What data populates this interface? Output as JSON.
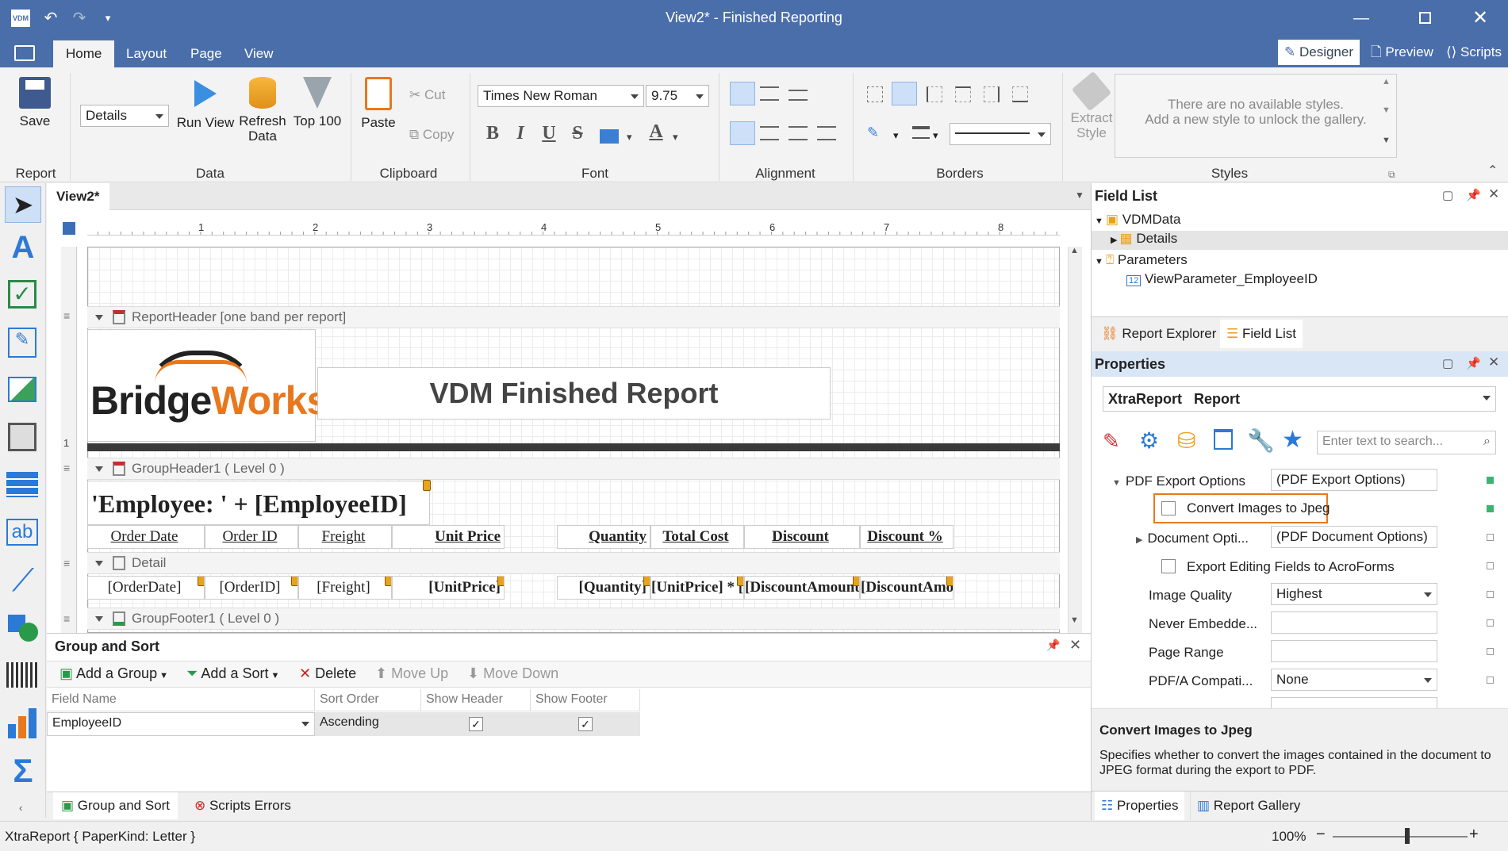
{
  "window": {
    "title": "View2* - Finished Reporting",
    "logo": "VDM"
  },
  "menu": {
    "tabs": [
      "Home",
      "Layout",
      "Page",
      "View"
    ],
    "active_tab": "Home",
    "view_buttons": {
      "designer": "Designer",
      "preview": "Preview",
      "scripts": "Scripts"
    }
  },
  "ribbon": {
    "report": {
      "save": "Save",
      "group": "Report"
    },
    "data": {
      "datasource": "Details",
      "run_view": "Run View",
      "refresh": "Refresh Data",
      "top100": "Top 100",
      "group": "Data"
    },
    "clipboard": {
      "paste": "Paste",
      "cut": "Cut",
      "copy": "Copy",
      "group": "Clipboard"
    },
    "font": {
      "family": "Times New Roman",
      "size": "9.75",
      "group": "Font"
    },
    "alignment": {
      "group": "Alignment"
    },
    "borders": {
      "group": "Borders"
    },
    "styles": {
      "extract": "Extract Style",
      "empty_line1": "There are no available styles.",
      "empty_line2": "Add a new style to unlock the gallery.",
      "group": "Styles"
    }
  },
  "designer": {
    "doc_tab": "View2*",
    "ruler_marks": [
      "1",
      "2",
      "3",
      "4",
      "5",
      "6",
      "7",
      "8"
    ],
    "bands": {
      "report_header": "ReportHeader [one band per report]",
      "group_header": "GroupHeader1 ( Level 0 )",
      "detail": "Detail",
      "group_footer": "GroupFooter1 ( Level 0 )"
    },
    "logo_text": {
      "bridge": "Bridge",
      "works": "Works"
    },
    "report_title": "VDM Finished Report",
    "group_expression": "'Employee: ' + [EmployeeID]",
    "column_headers": [
      "Order Date",
      "Order ID",
      "Freight",
      "Unit Price",
      "Quantity",
      "Total Cost",
      "Discount Amount",
      "Discount %"
    ],
    "detail_cells": [
      "[OrderDate]",
      "[OrderID]",
      "[Freight]",
      "[UnitPrice]",
      "[Quantity]",
      "[UnitPrice] * [Q",
      "[DiscountAmount]",
      "[DiscountAmou"
    ]
  },
  "group_sort": {
    "title": "Group and Sort",
    "toolbar": {
      "add_group": "Add a Group",
      "add_sort": "Add a Sort",
      "delete": "Delete",
      "move_up": "Move Up",
      "move_down": "Move Down"
    },
    "columns": [
      "Field Name",
      "Sort Order",
      "Show Header",
      "Show Footer"
    ],
    "rows": [
      {
        "field": "EmployeeID",
        "order": "Ascending",
        "show_header": true,
        "show_footer": true
      }
    ],
    "bottom_tabs": {
      "group_sort": "Group and Sort",
      "scripts_errors": "Scripts Errors"
    }
  },
  "field_list": {
    "title": "Field List",
    "tree": {
      "root": "VDMData",
      "details": "Details",
      "parameters": "Parameters",
      "param1": "ViewParameter_EmployeeID"
    },
    "tabs": {
      "report_explorer": "Report Explorer",
      "field_list": "Field List"
    }
  },
  "properties": {
    "title": "Properties",
    "object": {
      "type": "XtraReport",
      "name": "Report"
    },
    "search_placeholder": "Enter text to search...",
    "rows": {
      "pdf_export_label": "PDF Export Options",
      "pdf_export_value": "(PDF Export Options)",
      "convert_images": "Convert Images to Jpeg",
      "document_label": "Document Opti...",
      "document_value": "(PDF Document Options)",
      "export_fields": "Export Editing Fields to AcroForms",
      "image_quality_label": "Image Quality",
      "image_quality_value": "Highest",
      "never_embedded_label": "Never Embedde...",
      "page_range_label": "Page Range",
      "pdfa_label": "PDF/A Compati...",
      "pdfa_value": "None"
    },
    "description": {
      "title": "Convert Images to Jpeg",
      "text": "Specifies whether to convert the images contained in the document to JPEG format during the export to PDF."
    },
    "tabs": {
      "properties": "Properties",
      "report_gallery": "Report Gallery"
    }
  },
  "status": {
    "left": "XtraReport { PaperKind: Letter }",
    "zoom": "100%",
    "zoom_fraction": 0.55
  },
  "colors": {
    "accent": "#4a6eaa",
    "highlight": "#e8781e"
  }
}
